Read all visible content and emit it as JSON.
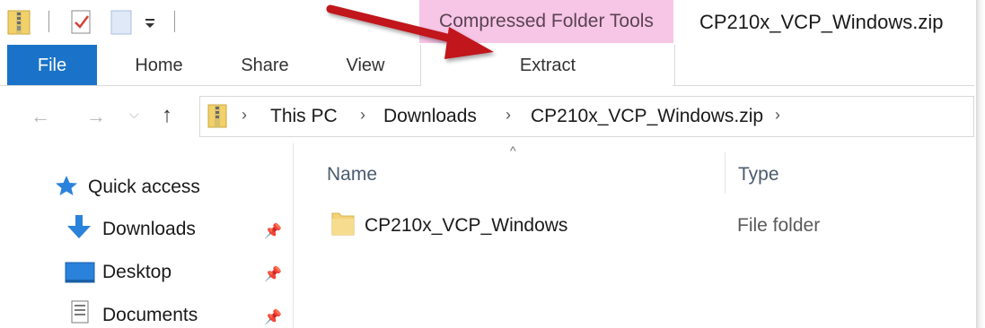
{
  "window": {
    "title": "CP210x_VCP_Windows.zip",
    "context_tab_header": "Compressed Folder Tools"
  },
  "ribbon": {
    "tabs": [
      {
        "label": "File"
      },
      {
        "label": "Home"
      },
      {
        "label": "Share"
      },
      {
        "label": "View"
      },
      {
        "label": "Extract"
      }
    ]
  },
  "address": {
    "crumbs": [
      "This PC",
      "Downloads",
      "CP210x_VCP_Windows.zip"
    ]
  },
  "navpane": {
    "items": [
      {
        "label": "Quick access",
        "icon": "star-icon"
      },
      {
        "label": "Downloads",
        "icon": "download-arrow-icon",
        "pinned": true
      },
      {
        "label": "Desktop",
        "icon": "desktop-icon",
        "pinned": true
      },
      {
        "label": "Documents",
        "icon": "documents-icon",
        "pinned": true
      }
    ]
  },
  "filelist": {
    "columns": [
      "Name",
      "Type"
    ],
    "rows": [
      {
        "name": "CP210x_VCP_Windows",
        "type": "File folder",
        "icon": "folder-icon"
      }
    ]
  },
  "colors": {
    "file_tab": "#1a73c9",
    "context_header": "#f7c5e6",
    "annotation_arrow": "#c0151b"
  }
}
